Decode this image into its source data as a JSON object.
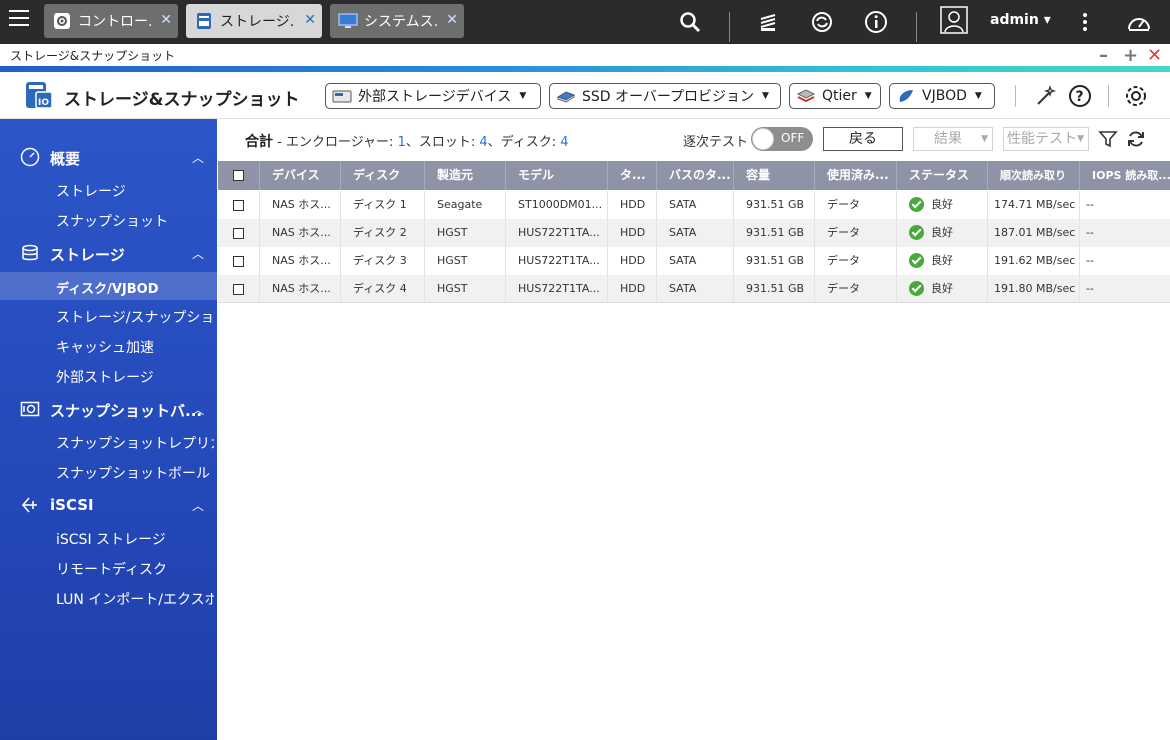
{
  "topbar": {
    "tabs": [
      {
        "label": "コントロー...",
        "icon": "gear-icon"
      },
      {
        "label": "ストレージ...",
        "icon": "storage-icon"
      },
      {
        "label": "システムス...",
        "icon": "monitor-icon"
      }
    ],
    "user": "admin"
  },
  "window": {
    "title": "ストレージ&スナップショット"
  },
  "header": {
    "app_title": "ストレージ&スナップショット",
    "buttons": [
      {
        "label": "外部ストレージデバイス"
      },
      {
        "label": "SSD オーバープロビジョン"
      },
      {
        "label": "Qtier"
      },
      {
        "label": "VJBOD"
      }
    ]
  },
  "sidebar": {
    "sections": [
      {
        "label": "概要",
        "icon": "dashboard-gauge-icon",
        "items": [
          "ストレージ",
          "スナップショット"
        ]
      },
      {
        "label": "ストレージ",
        "icon": "database-icon",
        "items": [
          "ディスク/VJBOD",
          "ストレージ/スナップショ...",
          "キャッシュ加速",
          "外部ストレージ"
        ]
      },
      {
        "label": "スナップショットバ...",
        "icon": "snapshot-camera-icon",
        "items": [
          "スナップショットレプリカ",
          "スナップショットボールト"
        ]
      },
      {
        "label": "iSCSI",
        "icon": "iscsi-icon",
        "items": [
          "iSCSI ストレージ",
          "リモートディスク",
          "LUN インポート/エクスポ..."
        ]
      }
    ],
    "selected": "ディスク/VJBOD"
  },
  "summary": {
    "total_label": "合計",
    "enclosure_label": " - エンクロージャー: ",
    "enclosure_count": "1",
    "slot_label": "、スロット: ",
    "slot_count": "4",
    "disk_label": "、ディスク: ",
    "disk_count": "4"
  },
  "controls": {
    "sequential_test_label": "逐次テスト",
    "toggle_state": "OFF",
    "back_label": "戻る",
    "result_label": "結果",
    "perf_test_label": "性能テスト"
  },
  "table": {
    "columns": [
      "デバイス",
      "ディスク",
      "製造元",
      "モデル",
      "タ...",
      "バスのタ...",
      "容量",
      "使用済み...",
      "ステータス",
      "順次読み取り",
      "IOPS 読み取..."
    ],
    "rows": [
      {
        "device": "NAS ホス...",
        "disk": "ディスク 1",
        "vendor": "Seagate",
        "model": "ST1000DM01...",
        "type": "HDD",
        "bus": "SATA",
        "capacity": "931.51 GB",
        "used": "データ",
        "status": "良好",
        "seq_read": "174.71 MB/sec",
        "iops": "--"
      },
      {
        "device": "NAS ホス...",
        "disk": "ディスク 2",
        "vendor": "HGST",
        "model": "HUS722T1TA...",
        "type": "HDD",
        "bus": "SATA",
        "capacity": "931.51 GB",
        "used": "データ",
        "status": "良好",
        "seq_read": "187.01 MB/sec",
        "iops": "--"
      },
      {
        "device": "NAS ホス...",
        "disk": "ディスク 3",
        "vendor": "HGST",
        "model": "HUS722T1TA...",
        "type": "HDD",
        "bus": "SATA",
        "capacity": "931.51 GB",
        "used": "データ",
        "status": "良好",
        "seq_read": "191.62 MB/sec",
        "iops": "--"
      },
      {
        "device": "NAS ホス...",
        "disk": "ディスク 4",
        "vendor": "HGST",
        "model": "HUS722T1TA...",
        "type": "HDD",
        "bus": "SATA",
        "capacity": "931.51 GB",
        "used": "データ",
        "status": "良好",
        "seq_read": "191.80 MB/sec",
        "iops": "--"
      }
    ]
  },
  "colors": {
    "accent": "#2a6fd6",
    "sidebar": "#2448b8",
    "table_header": "#8f93a6",
    "status_ok": "#48a83c"
  }
}
